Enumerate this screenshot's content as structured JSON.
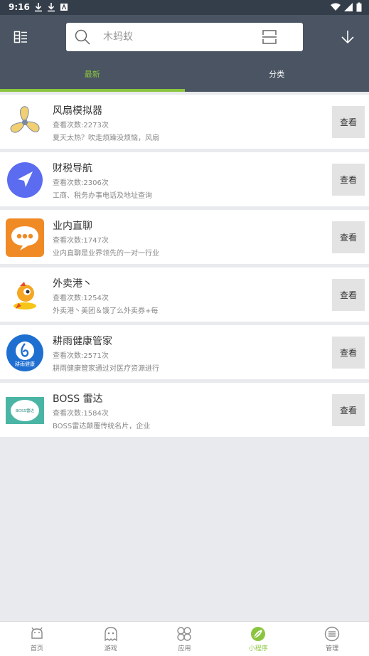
{
  "status_bar": {
    "time": "9:16"
  },
  "header": {
    "search_placeholder": "木蚂蚁"
  },
  "tabs": [
    {
      "label": "最新",
      "active": true
    },
    {
      "label": "分类",
      "active": false
    }
  ],
  "items": [
    {
      "title": "风扇模拟器",
      "views": "查看次数:2273次",
      "desc": "夏天太热？吹走烦躁没烦恼，风扇",
      "button": "查看",
      "icon": "fan-icon"
    },
    {
      "title": "财税导航",
      "views": "查看次数:2306次",
      "desc": "工商、税务办事电话及地址查询",
      "button": "查看",
      "icon": "navigation-icon"
    },
    {
      "title": "业内直聊",
      "views": "查看次数:1747次",
      "desc": "业内直聊是业界领先的一对一行业",
      "button": "查看",
      "icon": "chat-icon"
    },
    {
      "title": "外卖港丶",
      "views": "查看次数:1254次",
      "desc": "外卖港丶美团＆饿了么外卖券+每",
      "button": "查看",
      "icon": "rocket-icon"
    },
    {
      "title": "耕雨健康管家",
      "views": "查看次数:2571次",
      "desc": "耕雨健康管家通过对医疗资源进行",
      "button": "查看",
      "icon": "health-icon",
      "icon_text": "耕雨健康"
    },
    {
      "title": "BOSS 雷达",
      "views": "查看次数:1584次",
      "desc": "BOSS雷达颠覆传统名片，企业",
      "button": "查看",
      "icon": "boss-radar-icon",
      "icon_text": "BOSS雷达"
    }
  ],
  "bottom_nav": [
    {
      "label": "首页",
      "icon": "android-icon",
      "active": false
    },
    {
      "label": "游戏",
      "icon": "ghost-icon",
      "active": false
    },
    {
      "label": "应用",
      "icon": "apps-icon",
      "active": false
    },
    {
      "label": "小程序",
      "icon": "leaf-icon",
      "active": true
    },
    {
      "label": "管理",
      "icon": "manage-icon",
      "active": false
    }
  ],
  "colors": {
    "accent": "#8bc53f",
    "header": "#4a5462",
    "status_bar": "#343d4a"
  }
}
